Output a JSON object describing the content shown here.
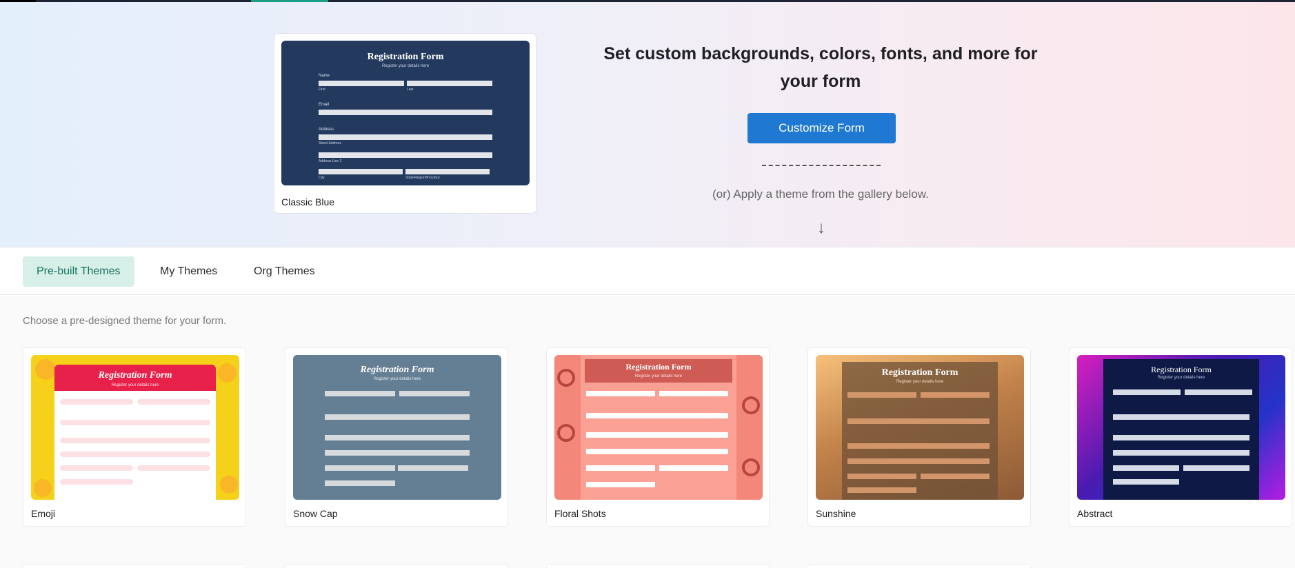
{
  "hero": {
    "current_theme": {
      "name": "Classic Blue",
      "preview": {
        "title": "Registration Form",
        "subtitle": "Register your details here",
        "labels": [
          "Name",
          "First",
          "Last",
          "Email",
          "Address",
          "Street Address",
          "Address Line 2",
          "City",
          "State/Region/Province"
        ]
      }
    },
    "headline": "Set custom backgrounds, colors, fonts, and more for your form",
    "customize_button": "Customize Form",
    "apply_text": "(or) Apply a theme from the gallery below.",
    "arrow": "↓"
  },
  "tabs": [
    {
      "label": "Pre-built Themes",
      "active": true
    },
    {
      "label": "My Themes",
      "active": false
    },
    {
      "label": "Org Themes",
      "active": false
    }
  ],
  "gallery": {
    "hint": "Choose a pre-designed theme for your form.",
    "themes": [
      {
        "name": "Emoji",
        "form_title": "Registration Form",
        "form_subtitle": "Register your details here",
        "bg": "#f5d219",
        "panel": "#ffffff",
        "header": "#e8214a",
        "field": "#fde0e4",
        "text": "#c2223f"
      },
      {
        "name": "Snow Cap",
        "form_title": "Registration Form",
        "form_subtitle": "Register your details here",
        "bg": "#647e94",
        "panel": "#647e94",
        "header": "#647e94",
        "field": "#d7dadd",
        "text": "#ffffff"
      },
      {
        "name": "Floral Shots",
        "form_title": "Registration Form",
        "form_subtitle": "Register your details here",
        "bg": "#f2877a",
        "panel": "#fba094",
        "header": "#cf5b55",
        "field": "#ffffff",
        "text": "#ffffff"
      },
      {
        "name": "Sunshine",
        "form_title": "Registration Form",
        "form_subtitle": "Register your details here",
        "bg": "#c2824a",
        "panel": "#7a5a3e",
        "header": "#7a5a3e",
        "field": "#d3956a",
        "text": "#ffffff"
      },
      {
        "name": "Abstract",
        "form_title": "Registration Form",
        "form_subtitle": "Register your details here",
        "bg": "#4a1bb0",
        "panel": "#0e1a45",
        "header": "#0e1a45",
        "field": "#d6dbe8",
        "text": "#ffffff"
      }
    ]
  },
  "colors": {
    "accent": "#1f78d1",
    "tab_active_bg": "#d6efe8",
    "tab_active_text": "#16735f",
    "classic_blue": "#233a5e"
  }
}
